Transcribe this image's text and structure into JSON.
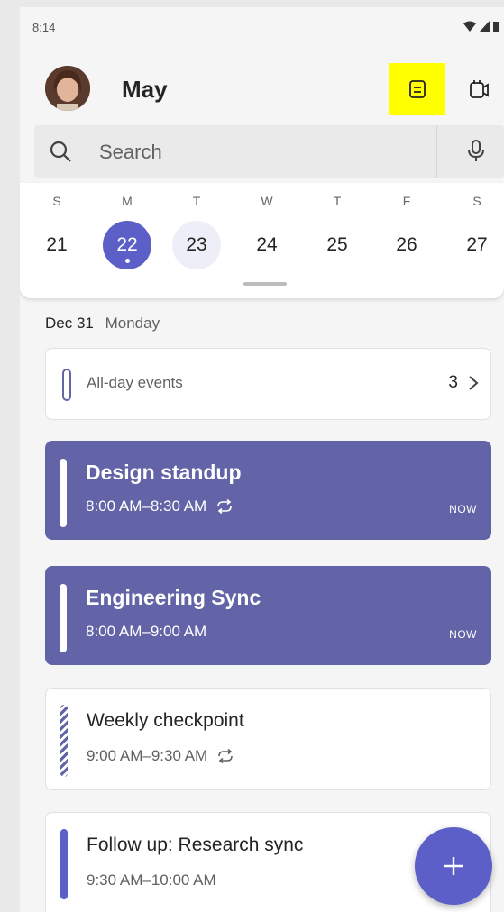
{
  "status_bar": {
    "time": "8:14",
    "icons": [
      "wifi-icon",
      "signal-icon",
      "battery-icon"
    ]
  },
  "header": {
    "month": "May",
    "agenda_icon": "agenda-view-icon",
    "meet_icon": "meet-now-icon",
    "highlight_color": "#ffff00"
  },
  "search": {
    "placeholder": "Search",
    "icon": "search-icon",
    "mic_icon": "mic-icon"
  },
  "week": {
    "days": [
      {
        "dow": "S",
        "num": "21"
      },
      {
        "dow": "M",
        "num": "22",
        "selected": true
      },
      {
        "dow": "T",
        "num": "23",
        "today": true
      },
      {
        "dow": "W",
        "num": "24"
      },
      {
        "dow": "T",
        "num": "25"
      },
      {
        "dow": "F",
        "num": "26"
      },
      {
        "dow": "S",
        "num": "27"
      }
    ]
  },
  "agenda": {
    "date": "Dec 31",
    "weekday": "Monday",
    "all_day": {
      "label": "All-day events",
      "count": "3"
    },
    "events": [
      {
        "title": "Design standup",
        "time": "8:00 AM–8:30 AM",
        "recurring": true,
        "badge": "NOW",
        "style": "filled"
      },
      {
        "title": "Engineering Sync",
        "time": "8:00 AM–9:00 AM",
        "recurring": false,
        "badge": "NOW",
        "style": "filled"
      },
      {
        "title": "Weekly checkpoint",
        "time": "9:00 AM–9:30 AM",
        "recurring": true,
        "style": "tentative"
      },
      {
        "title": "Follow up: Research sync",
        "time": "9:30 AM–10:00 AM",
        "recurring": false,
        "style": "outline"
      }
    ]
  },
  "fab": {
    "icon": "add-icon"
  },
  "colors": {
    "accent": "#6264a7",
    "accent_dark": "#5b5fc7"
  }
}
